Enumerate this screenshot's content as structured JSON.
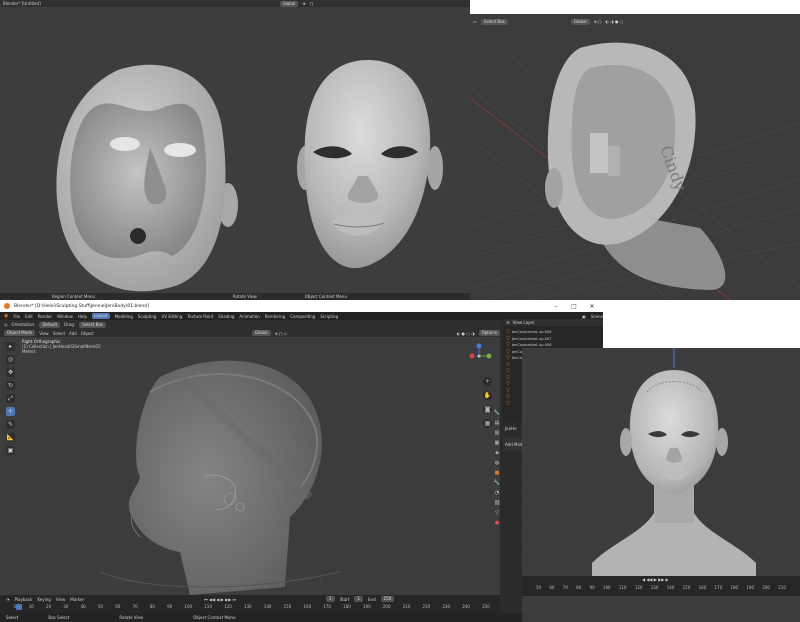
{
  "top_left": {
    "window_title": "Blender* [Untitled]",
    "orientation": "Global",
    "status_left": "Region Context Menu"
  },
  "top_mid": {
    "status_left": "Rotate View",
    "status_right": "Object Context Menu"
  },
  "top_right": {
    "select_mode": "Select Box",
    "orientation": "Global",
    "signature": "Cindy"
  },
  "main_window": {
    "title": "Blender* [D:\\Helvi\\Sculpting Stuff\\Jennie\\Jen\\Body\\01.blend]",
    "menu": [
      "File",
      "Edit",
      "Render",
      "Window",
      "Help"
    ],
    "workspace_tabs": [
      "Layout",
      "Modeling",
      "Sculpting",
      "UV Editing",
      "Texture Paint",
      "Shading",
      "Animation",
      "Rendering",
      "Compositing",
      "Scripting"
    ],
    "active_tab": "Layout",
    "toolbar": {
      "orientation_label": "Orientation:",
      "orientation": "Default",
      "drag_label": "Drag:",
      "drag": "Select Box",
      "pivot": "Global",
      "options": "Options"
    },
    "header": {
      "mode": "Object Mode",
      "view": "View",
      "select": "Select",
      "add": "Add",
      "object": "Object"
    },
    "overlay_info": {
      "view_name": "Right Orthographic",
      "collection": "(1) Collection | JenHead03SmallNeck02",
      "units": "Meters"
    },
    "timeline": {
      "playback": "Playback",
      "keying": "Keying",
      "view": "View",
      "marker": "Marker",
      "current_frame": "1",
      "start_label": "Start",
      "start": "1",
      "end_label": "End",
      "end": "250",
      "ticks": [
        "0",
        "10",
        "20",
        "30",
        "40",
        "50",
        "60",
        "70",
        "80",
        "90",
        "100",
        "110",
        "120",
        "130",
        "140",
        "150",
        "160",
        "170",
        "180",
        "190",
        "200",
        "210",
        "220",
        "230",
        "240",
        "250"
      ]
    },
    "status_bar": {
      "select": "Select",
      "box_select": "Box Select",
      "rotate_view": "Rotate View",
      "context_menu": "Object Context Menu"
    }
  },
  "outliner": {
    "scene": "Scene",
    "view_layer": "View Layer",
    "rows": [
      "JenCostomiseL.sp.006",
      "JenCostomiseL.sp.007",
      "JenCostomiseL.sp.008",
      "JenCostomiseL.sp.009",
      "JenCostomiseL.sp.010"
    ],
    "properties_object": "JenHe",
    "add_modifier": "Add Modi"
  },
  "front_view": {
    "ticks": [
      "50",
      "60",
      "70",
      "80",
      "90",
      "100",
      "110",
      "120",
      "130",
      "140",
      "150",
      "160",
      "170",
      "180",
      "190",
      "200",
      "210"
    ]
  },
  "colors": {
    "viewport_bg": "#3d3d3d",
    "panel_bg": "#2b2b2b",
    "title_bar": "#ffffff",
    "active_tab": "#4f77b7",
    "accent_orange": "#e07b2a",
    "sculpt_gray": "#b9b9b9"
  }
}
